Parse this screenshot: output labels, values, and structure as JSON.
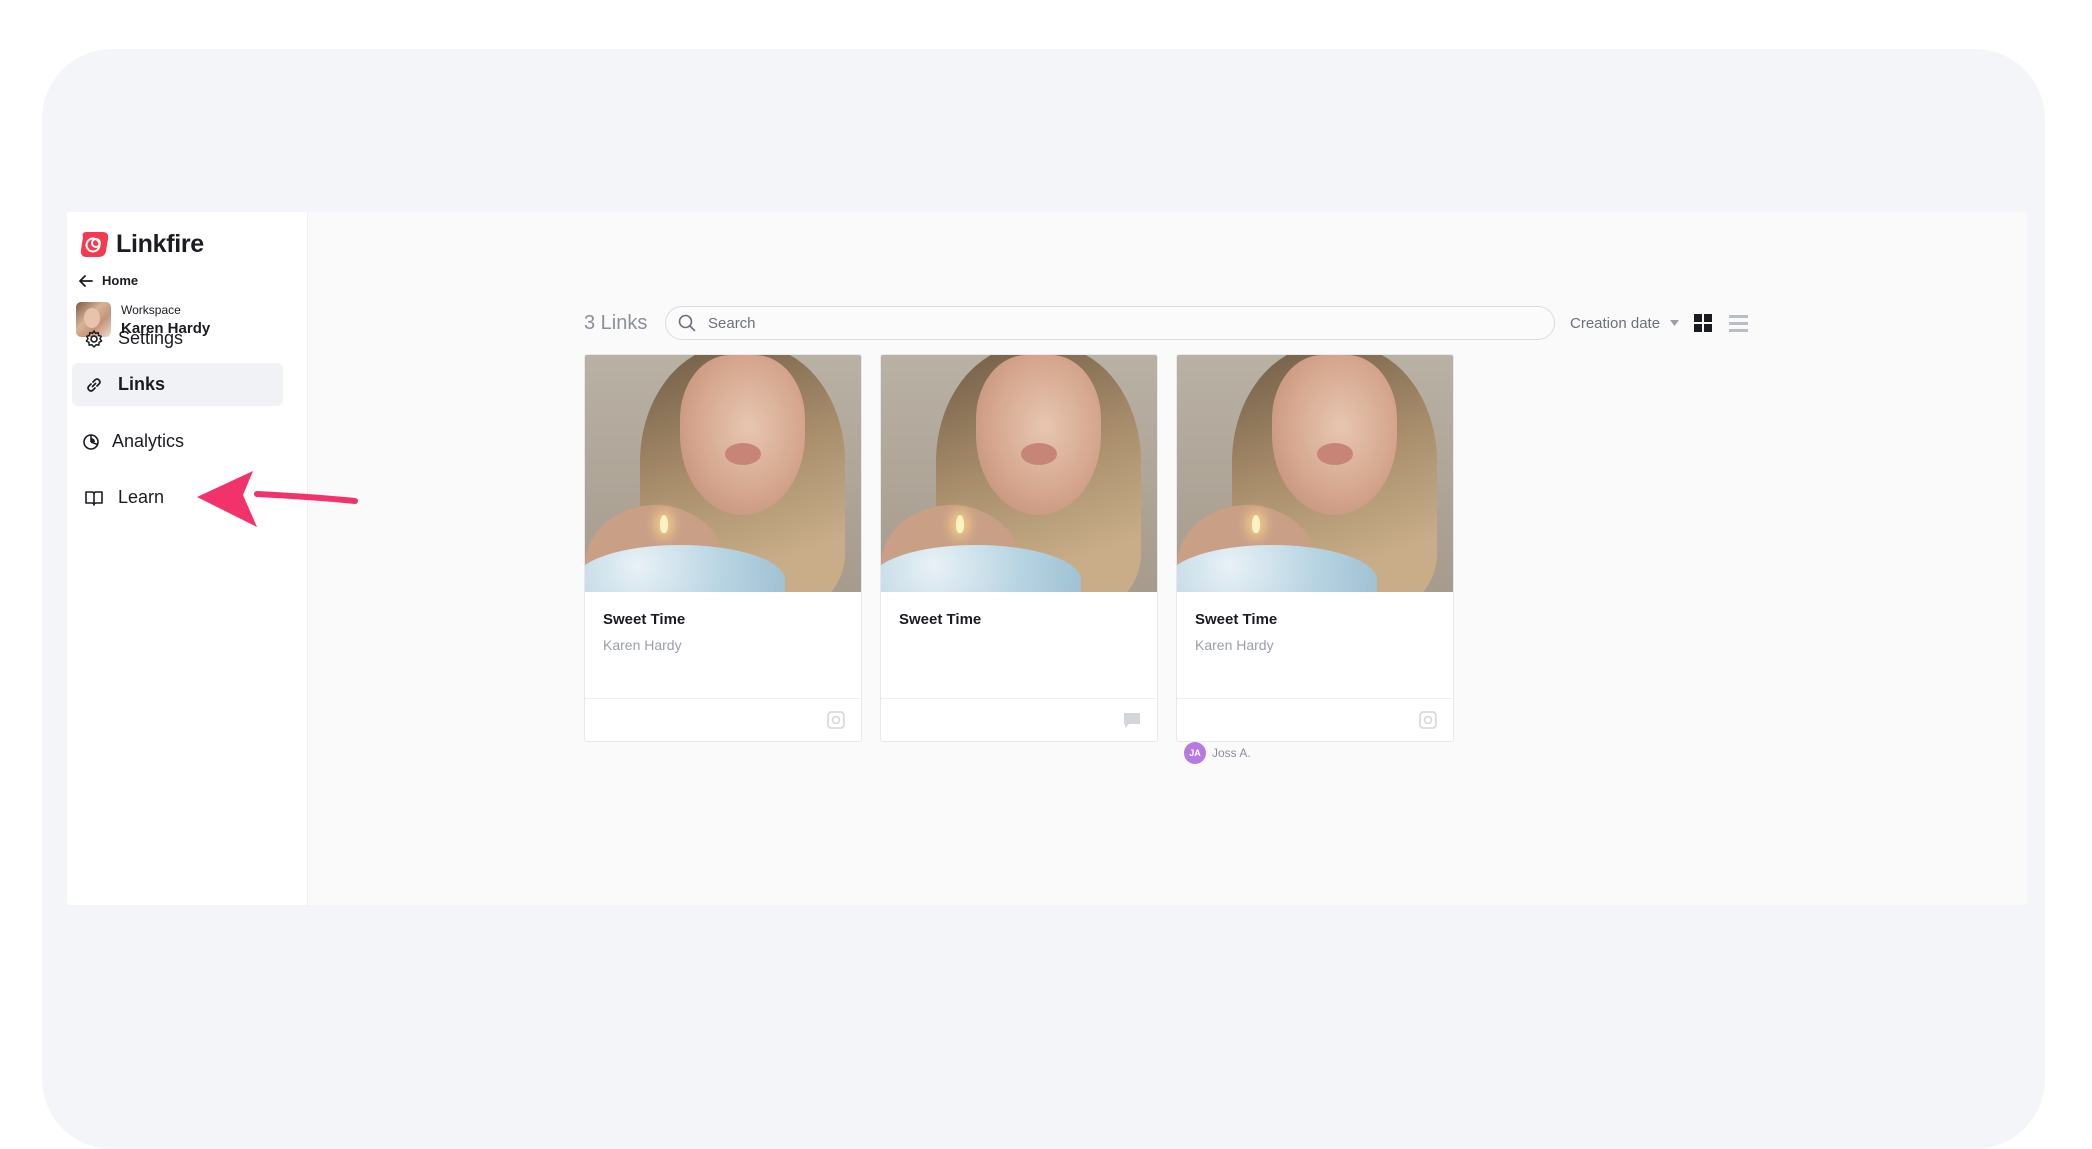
{
  "brand": {
    "name": "Linkfire",
    "color": "#f23b4e"
  },
  "sidebar": {
    "back_label": "Home",
    "workspace": {
      "label": "Workspace",
      "name": "Karen Hardy"
    },
    "items": [
      {
        "label": "Settings",
        "icon": "gear-icon",
        "active": false
      },
      {
        "label": "Links",
        "icon": "link-icon",
        "active": true
      },
      {
        "label": "Analytics",
        "icon": "pie-chart-icon",
        "active": false
      },
      {
        "label": "Learn",
        "icon": "book-icon",
        "active": false
      }
    ]
  },
  "toolbar": {
    "count_label": "3 Links",
    "search_placeholder": "Search",
    "sort_label": "Creation date",
    "view_mode": "grid"
  },
  "cards": [
    {
      "title": "Sweet Time",
      "artist": "Karen Hardy",
      "footer_icon": "status-icon"
    },
    {
      "title": "Sweet Time",
      "artist": "",
      "footer_icon": "comment-icon"
    },
    {
      "title": "Sweet Time",
      "artist": "Karen Hardy",
      "footer_icon": "status-icon"
    }
  ],
  "contributor": {
    "initials": "JA",
    "name": "Joss A.",
    "color": "#b57be0"
  },
  "annotation": {
    "arrow_color": "#f2336b",
    "points_to": "Analytics"
  }
}
